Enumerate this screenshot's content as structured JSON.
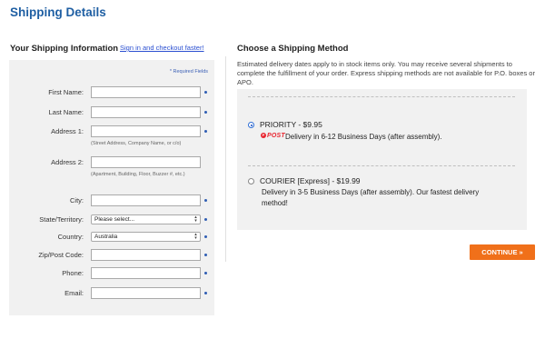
{
  "page": {
    "title": "Shipping Details"
  },
  "shipping_info": {
    "heading": "Your Shipping Information",
    "signin_link": "Sign in and checkout faster!",
    "required_note": "* Required Fields",
    "fields": {
      "first_name": {
        "label": "First Name:",
        "value": ""
      },
      "last_name": {
        "label": "Last Name:",
        "value": ""
      },
      "address1": {
        "label": "Address 1:",
        "value": "",
        "hint": "(Street Address, Company Name, or c/o)"
      },
      "address2": {
        "label": "Address 2:",
        "value": "",
        "hint": "(Apartment, Building, Floor, Buzzer #, etc.)"
      },
      "city": {
        "label": "City:",
        "value": ""
      },
      "state": {
        "label": "State/Territory:",
        "value": "Please select..."
      },
      "country": {
        "label": "Country:",
        "value": "Australia"
      },
      "zip": {
        "label": "Zip/Post Code:",
        "value": ""
      },
      "phone": {
        "label": "Phone:",
        "value": ""
      },
      "email": {
        "label": "Email:",
        "value": ""
      }
    }
  },
  "shipping_method": {
    "heading": "Choose a Shipping Method",
    "intro": "Estimated delivery dates apply to in stock items only. You may receive several shipments to complete the fulfillment of your order. Express shipping methods are not available for P.O. boxes or APO.",
    "options": [
      {
        "title": "PRIORITY - $9.95",
        "carrier": "POST",
        "description": "Delivery in 6-12 Business Days (after assembly).",
        "selected": true
      },
      {
        "title": "COURIER [Express] - $19.99",
        "description_line1": "Delivery in 3-5 Business Days (after assembly). Our fastest delivery",
        "description_line2": "method!",
        "selected": false
      }
    ],
    "continue_label": "CONTINUE »"
  },
  "colors": {
    "title_blue": "#1f5fa3",
    "accent_orange": "#f0701a",
    "auspost_red": "#e8252f"
  }
}
